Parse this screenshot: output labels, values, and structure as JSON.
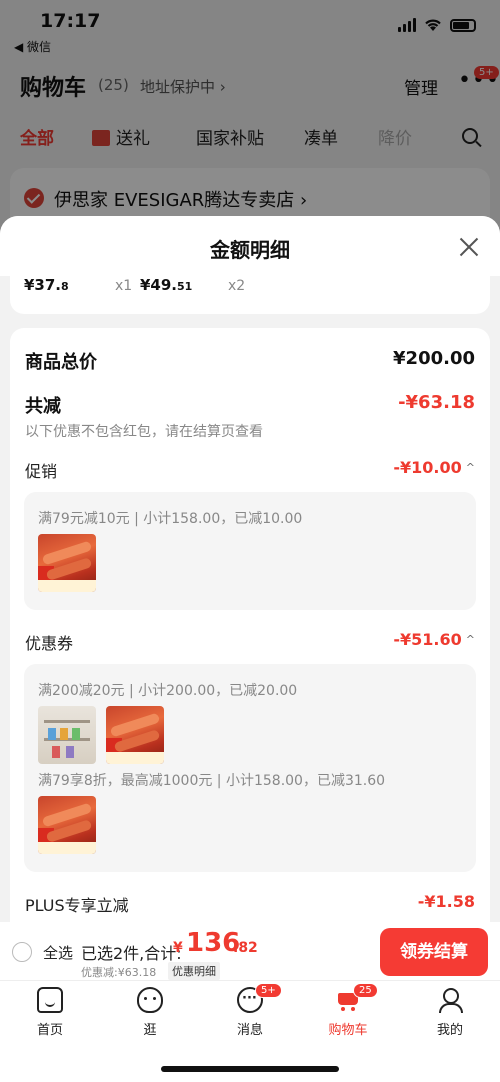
{
  "status_bar": {
    "time": "17:17",
    "back_app": "◀ 微信"
  },
  "cart_header": {
    "title": "购物车",
    "count": "(25)",
    "address_protect": "地址保护中 ›",
    "manage": "管理",
    "more": "•••",
    "more_badge": "5+"
  },
  "cart_tabs": [
    "全部",
    "送礼",
    "国家补贴",
    "凑单",
    "降价"
  ],
  "store": {
    "name": "伊思家 EVESIGAR腾达专卖店 ›"
  },
  "sheet": {
    "title": "金额明细",
    "strip": [
      {
        "price_int": "¥37.",
        "price_dec": "8",
        "qty": "x1"
      },
      {
        "price_int": "¥49.",
        "price_dec": "51",
        "qty": "x2"
      }
    ],
    "total_label": "商品总价",
    "total_value": "¥200.00",
    "reduce_label": "共减",
    "reduce_value": "-¥63.18",
    "reduce_hint": "以下优惠不包含红包，请在结算页查看",
    "promo": {
      "label": "促销",
      "value": "-¥10.00",
      "rule": "满79元减10元 | 小计158.00，已减10.00"
    },
    "coupon": {
      "label": "优惠券",
      "value": "-¥51.60",
      "rule1": "满200减20元 | 小计200.00，已减20.00",
      "rule2": "满79享8折，最高减1000元 | 小计158.00，已减31.60"
    },
    "plus": {
      "label": "PLUS专享立减",
      "value": "-¥1.58"
    }
  },
  "checkout": {
    "select_all": "全选",
    "selected": "已选2件,合计:",
    "currency": "¥",
    "amount_int": "136",
    "amount_dec": ".82",
    "saved": "优惠减:¥63.18",
    "detail_link": "优惠明细",
    "button": "领券结算"
  },
  "tab_bar": {
    "items": [
      {
        "label": "首页",
        "icon": "home-icon"
      },
      {
        "label": "逛",
        "icon": "stroll-icon"
      },
      {
        "label": "消息",
        "icon": "message-icon",
        "badge": "5+"
      },
      {
        "label": "购物车",
        "icon": "cart-icon",
        "badge": "25"
      },
      {
        "label": "我的",
        "icon": "profile-icon"
      }
    ]
  },
  "colors": {
    "accent": "#ee3a2f",
    "checkout_button": "#f53b34"
  }
}
